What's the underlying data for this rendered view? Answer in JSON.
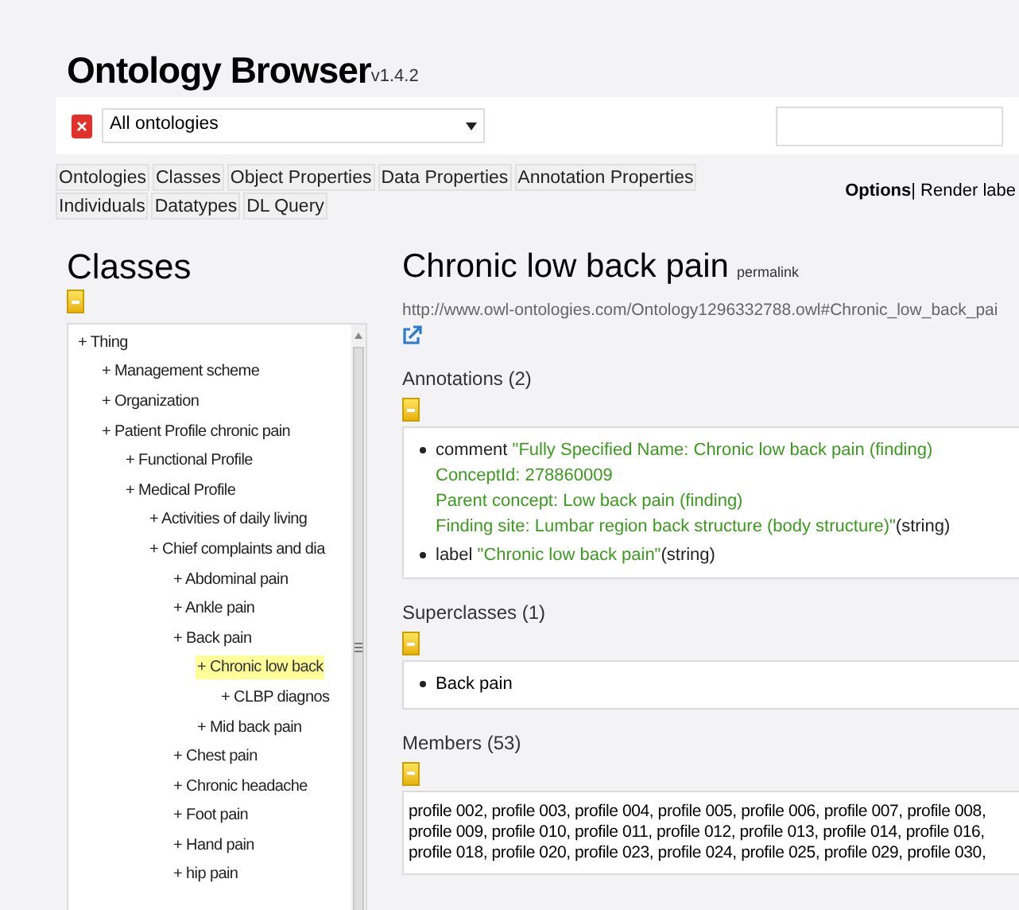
{
  "app": {
    "title": "Ontology Browser",
    "version": "v1.4.2"
  },
  "toolbar": {
    "ontology_select": {
      "value": "All ontologies"
    }
  },
  "tabs": [
    {
      "label": "Ontologies"
    },
    {
      "label": "Classes"
    },
    {
      "label": "Object Properties"
    },
    {
      "label": "Data Properties"
    },
    {
      "label": "Annotation Properties"
    },
    {
      "label": "Individuals"
    },
    {
      "label": "Datatypes"
    },
    {
      "label": "DL Query"
    }
  ],
  "options": {
    "text": "**Options**| Render labe"
  },
  "classes": {
    "heading": "Classes",
    "tree": [
      {
        "label": "+ Thing",
        "selected": false,
        "children": [
          {
            "label": "+ Management scheme",
            "selected": false
          },
          {
            "label": "+ Organization",
            "selected": false
          },
          {
            "label": "+ Patient Profile chronic pain",
            "selected": false,
            "children": [
              {
                "label": "+ Functional Profile",
                "selected": false
              },
              {
                "label": "+ Medical Profile",
                "selected": false,
                "children": [
                  {
                    "label": "+ Activities of daily living",
                    "selected": false
                  },
                  {
                    "label": "+ Chief complaints and dia",
                    "selected": false,
                    "children": [
                      {
                        "label": "+ Abdominal pain",
                        "selected": false
                      },
                      {
                        "label": "+ Ankle pain",
                        "selected": false
                      },
                      {
                        "label": "+ Back pain",
                        "selected": false,
                        "children": [
                          {
                            "label": "+ Chronic low back",
                            "selected": true,
                            "children": [
                              {
                                "label": "+ CLBP diagnos",
                                "selected": false
                              }
                            ]
                          },
                          {
                            "label": "+ Mid back pain",
                            "selected": false
                          }
                        ]
                      },
                      {
                        "label": "+ Chest pain",
                        "selected": false
                      },
                      {
                        "label": "+ Chronic headache",
                        "selected": false
                      },
                      {
                        "label": "+ Foot pain",
                        "selected": false
                      },
                      {
                        "label": "+ Hand pain",
                        "selected": false
                      },
                      {
                        "label": "+ hip pain",
                        "selected": false
                      }
                    ]
                  }
                ]
              }
            ]
          }
        ]
      }
    ]
  },
  "entity": {
    "title": "Chronic low back pain",
    "permalink": "permalink",
    "iri": "http://www.owl-ontologies.com/Ontology1296332788.owl#Chronic_low_back_pai",
    "sections": [
      {
        "kind": "annotations",
        "heading": "Annotations (2)",
        "items": [
          {
            "property": "comment",
            "value_lines": [
              "\"Fully Specified Name: Chronic low back pain (finding)",
              "ConceptId: 278860009",
              "Parent concept: Low back pain (finding)",
              "Finding site: Lumbar region back structure (body structure)\""
            ],
            "datatype": "(string)"
          },
          {
            "property": "label",
            "value_lines": [
              "\"Chronic low back pain\""
            ],
            "datatype": "(string)"
          }
        ]
      },
      {
        "kind": "list",
        "heading": "Superclasses (1)",
        "items": [
          "Back pain"
        ]
      },
      {
        "kind": "text",
        "heading": "Members (53)",
        "text": "profile 002, profile 003, profile 004, profile 005, profile 006, profile 007, profile 008, profile 009, profile 010, profile 011, profile 012, profile 013, profile 014, profile 016, profile 018, profile 020, profile 023, profile 024, profile 025, profile 029, profile 030,"
      }
    ]
  }
}
